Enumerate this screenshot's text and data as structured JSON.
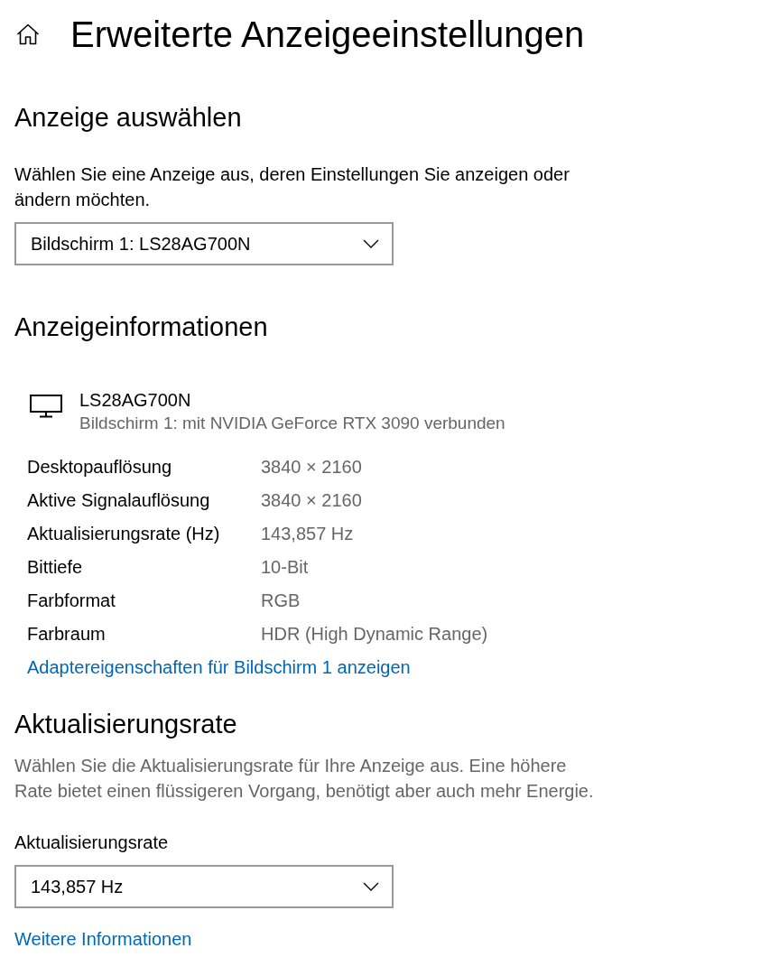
{
  "header": {
    "title": "Erweiterte Anzeigeeinstellungen"
  },
  "select_display": {
    "heading": "Anzeige auswählen",
    "description": "Wählen Sie eine Anzeige aus, deren Einstellungen Sie anzeigen oder ändern möchten.",
    "dropdown": {
      "value": "Bildschirm 1: LS28AG700N"
    }
  },
  "display_info": {
    "heading": "Anzeigeinformationen",
    "monitor": {
      "name": "LS28AG700N",
      "subtitle": "Bildschirm 1: mit NVIDIA GeForce RTX 3090 verbunden"
    },
    "properties": [
      {
        "label": "Desktopauflösung",
        "value": "3840 × 2160"
      },
      {
        "label": "Aktive Signalauflösung",
        "value": "3840 × 2160"
      },
      {
        "label": "Aktualisierungsrate (Hz)",
        "value": "143,857 Hz"
      },
      {
        "label": "Bittiefe",
        "value": "10-Bit"
      },
      {
        "label": "Farbformat",
        "value": "RGB"
      },
      {
        "label": "Farbraum",
        "value": "HDR (High Dynamic Range)"
      }
    ],
    "link": "Adaptereigenschaften für Bildschirm 1 anzeigen"
  },
  "refresh_rate": {
    "heading": "Aktualisierungsrate",
    "description": "Wählen Sie die Aktualisierungsrate für Ihre Anzeige aus. Eine höhere Rate bietet einen flüssigeren Vorgang, benötigt aber auch mehr Energie.",
    "label": "Aktualisierungsrate",
    "dropdown": {
      "value": "143,857 Hz"
    },
    "link": "Weitere Informationen"
  }
}
